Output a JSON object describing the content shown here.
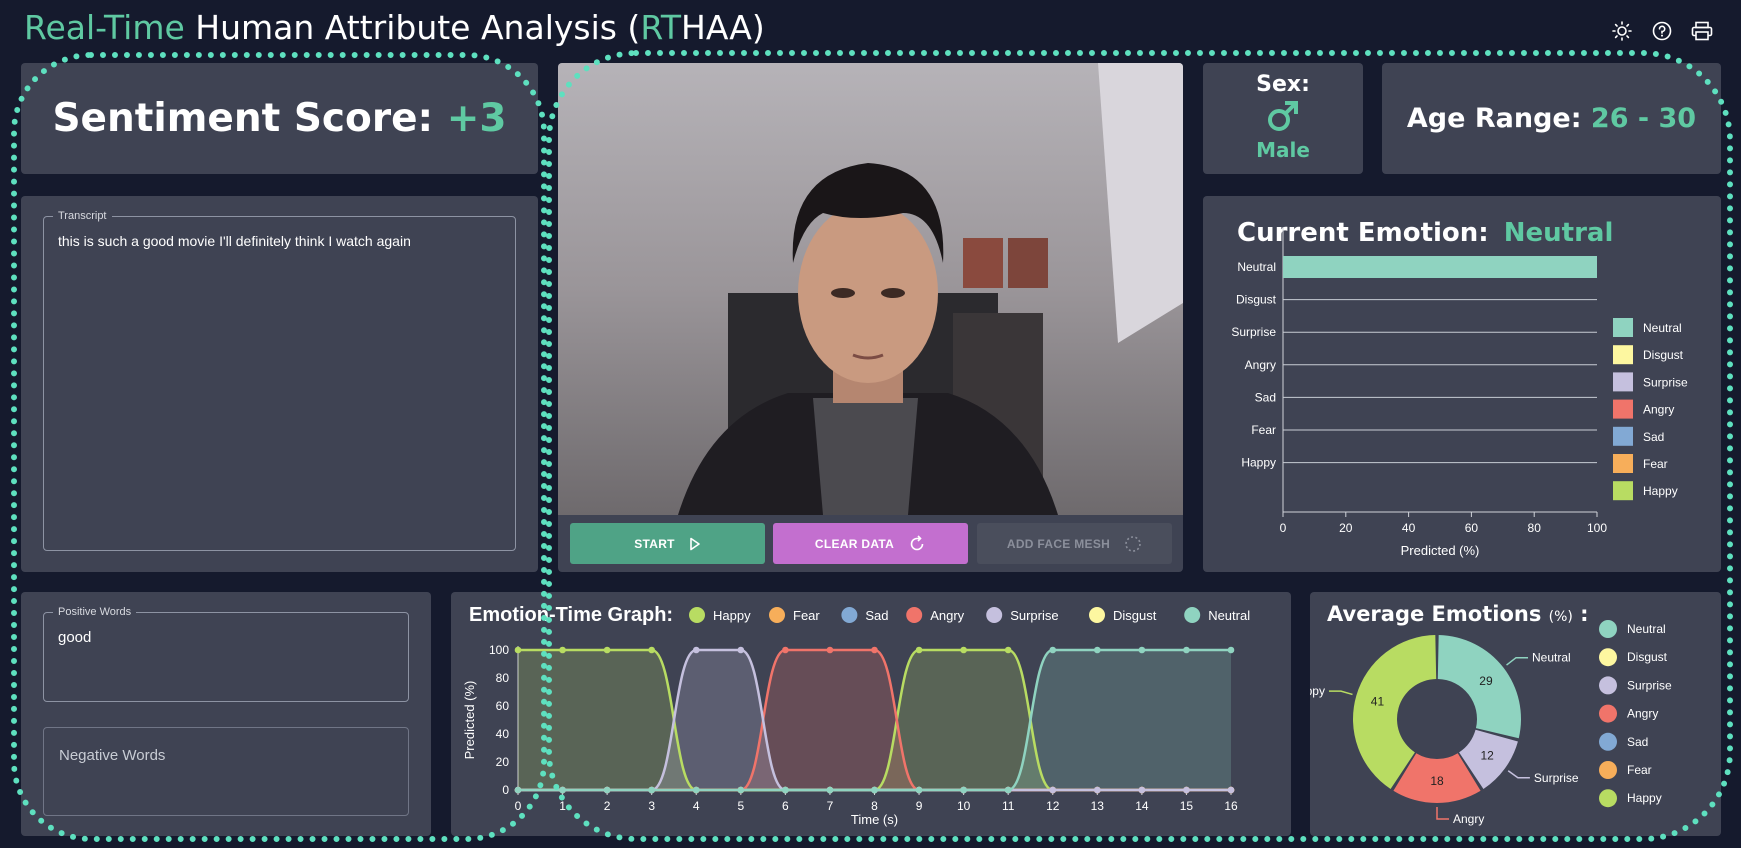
{
  "header": {
    "title_part1": "Real-Time",
    "title_part2": " Human Attribute Analysis (",
    "title_part3": "RT",
    "title_part4": "HAA)"
  },
  "toolbar_icons": [
    "sun-icon",
    "help-icon",
    "print-icon"
  ],
  "sentiment": {
    "label": "Sentiment Score:",
    "value": "+3"
  },
  "transcript": {
    "legend": "Transcript",
    "text": "this is such a good movie I'll definitely think I watch again"
  },
  "positive_words": {
    "legend": "Positive Words",
    "text": "good"
  },
  "negative_words": {
    "placeholder": "Negative Words"
  },
  "controls": {
    "start": "START",
    "clear": "CLEAR DATA",
    "face_mesh": "ADD FACE MESH"
  },
  "sex": {
    "label": "Sex:",
    "value": "Male"
  },
  "age": {
    "label": "Age Range:",
    "value": "26 - 30"
  },
  "current_emotion": {
    "label": "Current Emotion:",
    "value": "Neutral"
  },
  "colors": {
    "accent": "#5fc9a2",
    "Neutral": "#8fd3c0",
    "Disgust": "#fdf7a0",
    "Surprise": "#c5c0de",
    "Angry": "#f0746a",
    "Sad": "#82a9d4",
    "Fear": "#f7ae5a",
    "Happy": "#b8dc62",
    "start_btn": "#4fa386",
    "clear_btn": "#c36fcf"
  },
  "chart_data": [
    {
      "type": "bar",
      "orientation": "horizontal",
      "categories": [
        "Neutral",
        "Disgust",
        "Surprise",
        "Angry",
        "Sad",
        "Fear",
        "Happy"
      ],
      "values": [
        100,
        0,
        0,
        0,
        0,
        0,
        0
      ],
      "xlabel": "Predicted (%)",
      "xlim": [
        0,
        100
      ],
      "xticks": [
        "0",
        "20",
        "40",
        "60",
        "80",
        "100"
      ],
      "legend": [
        "Neutral",
        "Disgust",
        "Surprise",
        "Angry",
        "Sad",
        "Fear",
        "Happy"
      ],
      "legend_position": "right"
    },
    {
      "type": "area",
      "title": "Emotion-Time Graph:",
      "x": [
        0,
        1,
        2,
        3,
        4,
        5,
        6,
        7,
        8,
        9,
        10,
        11,
        12,
        13,
        14,
        15,
        16
      ],
      "xlabel": "Time (s)",
      "ylabel": "Predicted (%)",
      "ylim": [
        0,
        100
      ],
      "yticks": [
        "0",
        "20",
        "40",
        "60",
        "80",
        "100"
      ],
      "legend_position": "top",
      "series": [
        {
          "name": "Happy",
          "values": [
            100,
            100,
            100,
            100,
            0,
            0,
            0,
            0,
            0,
            100,
            100,
            100,
            0,
            0,
            0,
            0,
            0
          ]
        },
        {
          "name": "Fear",
          "values": [
            0,
            0,
            0,
            0,
            0,
            0,
            0,
            0,
            0,
            0,
            0,
            0,
            0,
            0,
            0,
            0,
            0
          ]
        },
        {
          "name": "Sad",
          "values": [
            0,
            0,
            0,
            0,
            0,
            0,
            0,
            0,
            0,
            0,
            0,
            0,
            0,
            0,
            0,
            0,
            0
          ]
        },
        {
          "name": "Angry",
          "values": [
            0,
            0,
            0,
            0,
            0,
            0,
            100,
            100,
            100,
            0,
            0,
            0,
            0,
            0,
            0,
            0,
            0
          ]
        },
        {
          "name": "Surprise",
          "values": [
            0,
            0,
            0,
            0,
            100,
            100,
            0,
            0,
            0,
            0,
            0,
            0,
            0,
            0,
            0,
            0,
            0
          ]
        },
        {
          "name": "Disgust",
          "values": [
            0,
            0,
            0,
            0,
            0,
            0,
            0,
            0,
            0,
            0,
            0,
            0,
            0,
            0,
            0,
            0,
            0
          ]
        },
        {
          "name": "Neutral",
          "values": [
            0,
            0,
            0,
            0,
            0,
            0,
            0,
            0,
            0,
            0,
            0,
            0,
            100,
            100,
            100,
            100,
            100
          ]
        }
      ]
    },
    {
      "type": "pie",
      "title": "Average Emotions",
      "title_unit": "(%)",
      "title_suffix": " :",
      "categories": [
        "Neutral",
        "Surprise",
        "Angry",
        "Happy"
      ],
      "values": [
        29,
        12,
        18,
        41
      ],
      "legend": [
        "Neutral",
        "Disgust",
        "Surprise",
        "Angry",
        "Sad",
        "Fear",
        "Happy"
      ],
      "legend_position": "right"
    }
  ]
}
